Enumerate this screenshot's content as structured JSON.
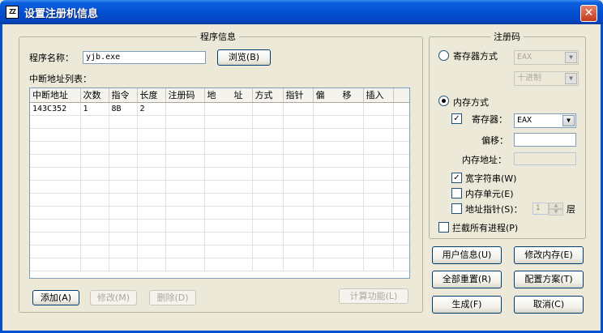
{
  "window": {
    "icon_text": "ZZ",
    "title": "设置注册机信息",
    "close_symbol": "✕"
  },
  "program_info": {
    "group_title": "程序信息",
    "program_name_label": "程序名称：",
    "program_name_value": "yjb.exe",
    "browse_button": "浏览(B)",
    "breakpoint_list_label": "中断地址列表："
  },
  "breakpoint_table": {
    "columns": [
      "中断地址",
      "次数",
      "指令",
      "长度",
      "注册码",
      "地　　址",
      "方式",
      "指针",
      "偏　　移",
      "插入"
    ],
    "rows": [
      [
        "143C352",
        "1",
        "8B",
        "2",
        "",
        "",
        "",
        "",
        "",
        ""
      ]
    ]
  },
  "actions": {
    "add": "添加(A)",
    "modify": "修改(M)",
    "delete": "删除(D)",
    "calc": "计算功能(L)"
  },
  "reg_code": {
    "group_title": "注册码",
    "register_mode_label": "寄存器方式",
    "register_mode_selected": false,
    "register_select_value": "EAX",
    "radix_select_value": "十进制",
    "memory_mode_label": "内存方式",
    "memory_mode_selected": true,
    "register_check_label": "寄存器：",
    "register_checked": true,
    "memory_register_value": "EAX",
    "offset_label": "偏移：",
    "offset_value": "",
    "memory_address_label": "内存地址：",
    "memory_address_value": "",
    "wide_string_label": "宽字符串(W)",
    "wide_string_checked": true,
    "memory_cell_label": "内存单元(E)",
    "memory_cell_checked": false,
    "address_pointer_label": "地址指针(S)：",
    "address_pointer_checked": false,
    "pointer_level_value": "1",
    "pointer_level_unit": "层",
    "intercept_all_label": "拦截所有进程(P)",
    "intercept_all_checked": false,
    "check_mark": "✓",
    "arrow_down": "▼",
    "arrow_up": "▲"
  },
  "buttons": {
    "user_info": "用户信息(U)",
    "modify_memory": "修改内存(E)",
    "reset_all": "全部重置(R)",
    "config_plan": "配置方案(T)",
    "generate": "生成(F)",
    "cancel": "取消(C)"
  },
  "colors": {
    "titlebar": "#0450d2",
    "dialog_bg": "#ece9d8",
    "close_button": "#c4391b"
  }
}
